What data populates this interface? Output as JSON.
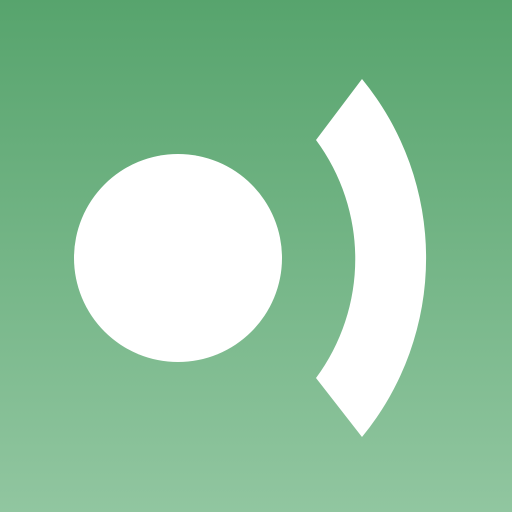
{
  "icon": {
    "name": "broadcast-dot-icon",
    "colors": {
      "gradient_top": "#57a46d",
      "gradient_bottom": "#91c6a0",
      "foreground": "#ffffff"
    }
  }
}
